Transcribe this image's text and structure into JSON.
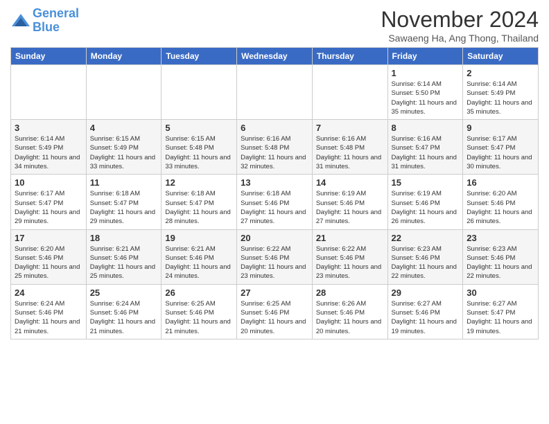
{
  "header": {
    "logo_line1": "General",
    "logo_line2": "Blue",
    "month": "November 2024",
    "location": "Sawaeng Ha, Ang Thong, Thailand"
  },
  "days_of_week": [
    "Sunday",
    "Monday",
    "Tuesday",
    "Wednesday",
    "Thursday",
    "Friday",
    "Saturday"
  ],
  "weeks": [
    [
      {
        "day": "",
        "info": ""
      },
      {
        "day": "",
        "info": ""
      },
      {
        "day": "",
        "info": ""
      },
      {
        "day": "",
        "info": ""
      },
      {
        "day": "",
        "info": ""
      },
      {
        "day": "1",
        "info": "Sunrise: 6:14 AM\nSunset: 5:50 PM\nDaylight: 11 hours and 35 minutes."
      },
      {
        "day": "2",
        "info": "Sunrise: 6:14 AM\nSunset: 5:49 PM\nDaylight: 11 hours and 35 minutes."
      }
    ],
    [
      {
        "day": "3",
        "info": "Sunrise: 6:14 AM\nSunset: 5:49 PM\nDaylight: 11 hours and 34 minutes."
      },
      {
        "day": "4",
        "info": "Sunrise: 6:15 AM\nSunset: 5:49 PM\nDaylight: 11 hours and 33 minutes."
      },
      {
        "day": "5",
        "info": "Sunrise: 6:15 AM\nSunset: 5:48 PM\nDaylight: 11 hours and 33 minutes."
      },
      {
        "day": "6",
        "info": "Sunrise: 6:16 AM\nSunset: 5:48 PM\nDaylight: 11 hours and 32 minutes."
      },
      {
        "day": "7",
        "info": "Sunrise: 6:16 AM\nSunset: 5:48 PM\nDaylight: 11 hours and 31 minutes."
      },
      {
        "day": "8",
        "info": "Sunrise: 6:16 AM\nSunset: 5:47 PM\nDaylight: 11 hours and 31 minutes."
      },
      {
        "day": "9",
        "info": "Sunrise: 6:17 AM\nSunset: 5:47 PM\nDaylight: 11 hours and 30 minutes."
      }
    ],
    [
      {
        "day": "10",
        "info": "Sunrise: 6:17 AM\nSunset: 5:47 PM\nDaylight: 11 hours and 29 minutes."
      },
      {
        "day": "11",
        "info": "Sunrise: 6:18 AM\nSunset: 5:47 PM\nDaylight: 11 hours and 29 minutes."
      },
      {
        "day": "12",
        "info": "Sunrise: 6:18 AM\nSunset: 5:47 PM\nDaylight: 11 hours and 28 minutes."
      },
      {
        "day": "13",
        "info": "Sunrise: 6:18 AM\nSunset: 5:46 PM\nDaylight: 11 hours and 27 minutes."
      },
      {
        "day": "14",
        "info": "Sunrise: 6:19 AM\nSunset: 5:46 PM\nDaylight: 11 hours and 27 minutes."
      },
      {
        "day": "15",
        "info": "Sunrise: 6:19 AM\nSunset: 5:46 PM\nDaylight: 11 hours and 26 minutes."
      },
      {
        "day": "16",
        "info": "Sunrise: 6:20 AM\nSunset: 5:46 PM\nDaylight: 11 hours and 26 minutes."
      }
    ],
    [
      {
        "day": "17",
        "info": "Sunrise: 6:20 AM\nSunset: 5:46 PM\nDaylight: 11 hours and 25 minutes."
      },
      {
        "day": "18",
        "info": "Sunrise: 6:21 AM\nSunset: 5:46 PM\nDaylight: 11 hours and 25 minutes."
      },
      {
        "day": "19",
        "info": "Sunrise: 6:21 AM\nSunset: 5:46 PM\nDaylight: 11 hours and 24 minutes."
      },
      {
        "day": "20",
        "info": "Sunrise: 6:22 AM\nSunset: 5:46 PM\nDaylight: 11 hours and 23 minutes."
      },
      {
        "day": "21",
        "info": "Sunrise: 6:22 AM\nSunset: 5:46 PM\nDaylight: 11 hours and 23 minutes."
      },
      {
        "day": "22",
        "info": "Sunrise: 6:23 AM\nSunset: 5:46 PM\nDaylight: 11 hours and 22 minutes."
      },
      {
        "day": "23",
        "info": "Sunrise: 6:23 AM\nSunset: 5:46 PM\nDaylight: 11 hours and 22 minutes."
      }
    ],
    [
      {
        "day": "24",
        "info": "Sunrise: 6:24 AM\nSunset: 5:46 PM\nDaylight: 11 hours and 21 minutes."
      },
      {
        "day": "25",
        "info": "Sunrise: 6:24 AM\nSunset: 5:46 PM\nDaylight: 11 hours and 21 minutes."
      },
      {
        "day": "26",
        "info": "Sunrise: 6:25 AM\nSunset: 5:46 PM\nDaylight: 11 hours and 21 minutes."
      },
      {
        "day": "27",
        "info": "Sunrise: 6:25 AM\nSunset: 5:46 PM\nDaylight: 11 hours and 20 minutes."
      },
      {
        "day": "28",
        "info": "Sunrise: 6:26 AM\nSunset: 5:46 PM\nDaylight: 11 hours and 20 minutes."
      },
      {
        "day": "29",
        "info": "Sunrise: 6:27 AM\nSunset: 5:46 PM\nDaylight: 11 hours and 19 minutes."
      },
      {
        "day": "30",
        "info": "Sunrise: 6:27 AM\nSunset: 5:47 PM\nDaylight: 11 hours and 19 minutes."
      }
    ]
  ]
}
